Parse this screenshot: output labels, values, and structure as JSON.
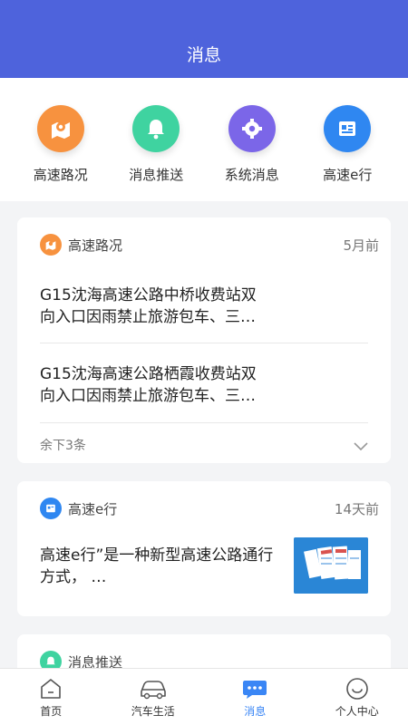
{
  "header": {
    "title": "消息"
  },
  "categories": [
    {
      "label": "高速路况",
      "icon": "map-pin-icon",
      "color": "#f7923f"
    },
    {
      "label": "消息推送",
      "icon": "bell-icon",
      "color": "#3fd3a0"
    },
    {
      "label": "系统消息",
      "icon": "gear-icon",
      "color": "#7b66e8"
    },
    {
      "label": "高速e行",
      "icon": "id-card-icon",
      "color": "#2f87f1"
    }
  ],
  "cards": {
    "traffic": {
      "name": "高速路况",
      "time": "5月前",
      "items": [
        {
          "text": "G15沈海高速公路中桥收费站双向入口因雨禁止旅游包车、三…"
        },
        {
          "text": "G15沈海高速公路栖霞收费站双向入口因雨禁止旅游包车、三…"
        }
      ],
      "more": "余下3条"
    },
    "ehang": {
      "name": "高速e行",
      "time": "14天前",
      "text": "高速e行”是一种新型高速公路通行方式， …",
      "thumb": "app-screens-image"
    },
    "push": {
      "name": "消息推送"
    }
  },
  "tabs": [
    {
      "label": "首页",
      "icon": "home-icon",
      "active": false
    },
    {
      "label": "汽车生活",
      "icon": "car-icon",
      "active": false
    },
    {
      "label": "消息",
      "icon": "message-icon",
      "active": true
    },
    {
      "label": "个人中心",
      "icon": "smile-icon",
      "active": false
    }
  ],
  "colors": {
    "header": "#4e63dc",
    "accent": "#3a86f5"
  }
}
